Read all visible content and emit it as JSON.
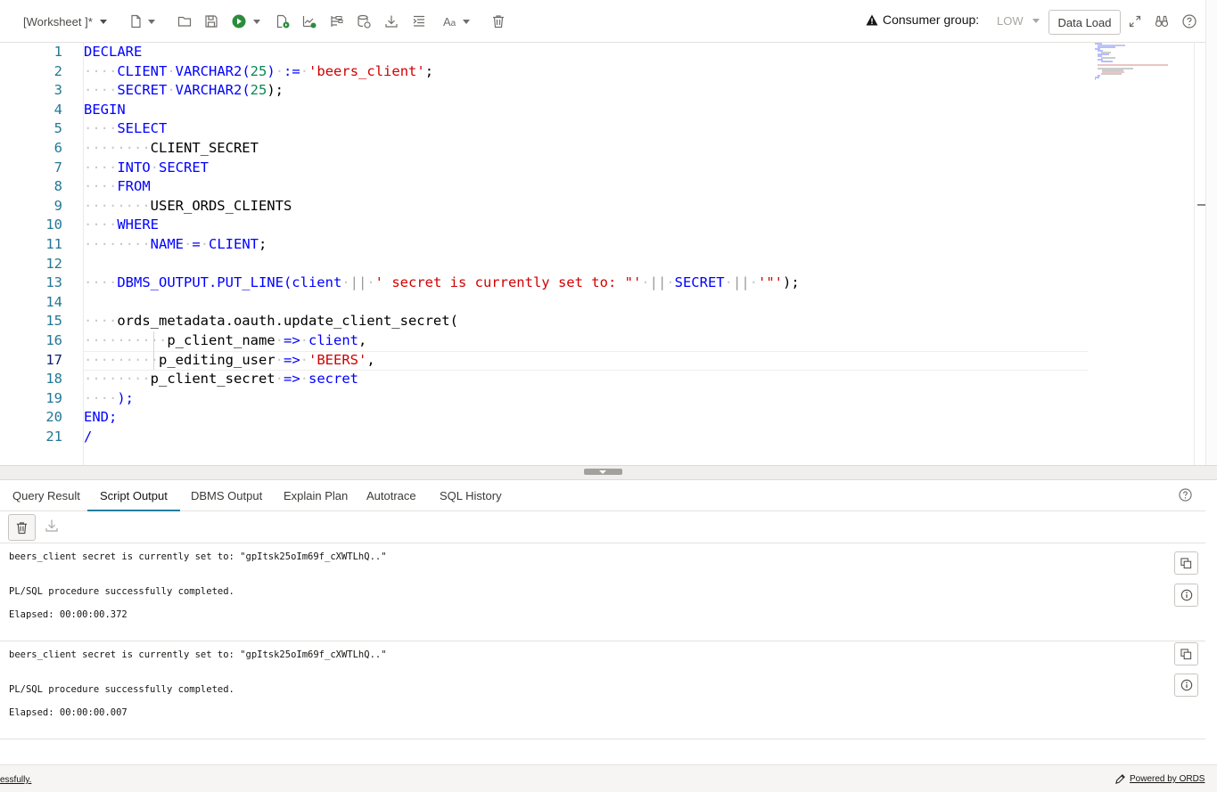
{
  "toolbar": {
    "worksheet_label": "[Worksheet ]*",
    "consumer_group_label": "Consumer group:",
    "consumer_group_value": "LOW",
    "data_load_label": "Data Load"
  },
  "editor": {
    "line_numbers": [
      "1",
      "2",
      "3",
      "4",
      "5",
      "6",
      "7",
      "8",
      "9",
      "10",
      "11",
      "12",
      "13",
      "14",
      "15",
      "16",
      "17",
      "18",
      "19",
      "20",
      "21"
    ],
    "code": {
      "l1_kw": "DECLARE",
      "l2_ind": "····",
      "l2_a": "CLIENT",
      "l2_b": "VARCHAR2(",
      "l2_n": "25",
      "l2_c": ")",
      "l2_d": ":=",
      "l2_s": "'beers_client'",
      "l2_e": ";",
      "l3_ind": "····",
      "l3_a": "SECRET",
      "l3_b": "VARCHAR2(",
      "l3_n": "25",
      "l3_c": ");",
      "l4_kw": "BEGIN",
      "l5_ind": "····",
      "l5_kw": "SELECT",
      "l6_ind": "········",
      "l6_t": "CLIENT_SECRET",
      "l7_ind": "····",
      "l7_kw": "INTO",
      "l7_a": "SECRET",
      "l8_ind": "····",
      "l8_kw": "FROM",
      "l9_ind": "········",
      "l9_t": "USER_ORDS_CLIENTS",
      "l10_ind": "····",
      "l10_kw": "WHERE",
      "l11_ind": "········",
      "l11_a": "NAME",
      "l11_b": "=",
      "l11_c": "CLIENT",
      "l11_d": ";",
      "l13_ind": "····",
      "l13_a": "DBMS_OUTPUT.PUT_LINE(",
      "l13_b": "client",
      "l13_c": "||",
      "l13_s1": "' secret is currently set to: \"'",
      "l13_d": "||",
      "l13_e": "SECRET",
      "l13_f": "||",
      "l13_s2": "'\"'",
      "l13_g": ");",
      "l15_ind": "····",
      "l15_a": "ords_metadata.oauth.update_client_secret(",
      "l16_ind": "··········",
      "l16_a": "p_client_name",
      "l16_b": "=>",
      "l16_c": "client",
      "l16_d": ",",
      "l17_ind": "·········",
      "l17_a": "p_editing_user",
      "l17_b": "=>",
      "l17_s": "'BEERS'",
      "l17_d": ",",
      "l18_ind": "········",
      "l18_a": "p_client_secret",
      "l18_b": "=>",
      "l18_c": "secret",
      "l19_ind": "····",
      "l19_a": ");",
      "l20_kw": "END;",
      "l21_kw": "/"
    }
  },
  "tabs": [
    "Query Result",
    "Script Output",
    "DBMS Output",
    "Explain Plan",
    "Autotrace",
    "SQL History"
  ],
  "active_tab": "Script Output",
  "outputs": [
    {
      "line1": "beers_client secret is currently set to: \"gpItsk25oIm69f_cXWTLhQ..\"",
      "line2": "PL/SQL procedure successfully completed.",
      "line3": "Elapsed: 00:00:00.372"
    },
    {
      "line1": "beers_client secret is currently set to: \"gpItsk25oIm69f_cXWTLhQ..\"",
      "line2": "PL/SQL procedure successfully completed.",
      "line3": "Elapsed: 00:00:00.007"
    }
  ],
  "footer": {
    "status_text": "essfully.",
    "powered_by": "Powered by ORDS"
  },
  "colors": {
    "keyword": "#0000ff",
    "string": "#d00000",
    "number": "#098658",
    "line_number": "#237893",
    "active_tab_underline": "#227e9e"
  },
  "icons": [
    "new-file-icon",
    "open-folder-icon",
    "save-icon",
    "run-statement-icon",
    "run-script-icon",
    "explain-plan-icon",
    "autotrace-icon",
    "sql-history-icon",
    "download-icon",
    "format-icon",
    "text-case-icon",
    "clear-icon",
    "warning-icon",
    "expand-icon",
    "binoculars-icon",
    "help-icon",
    "copy-icon",
    "info-icon",
    "pen-icon"
  ]
}
